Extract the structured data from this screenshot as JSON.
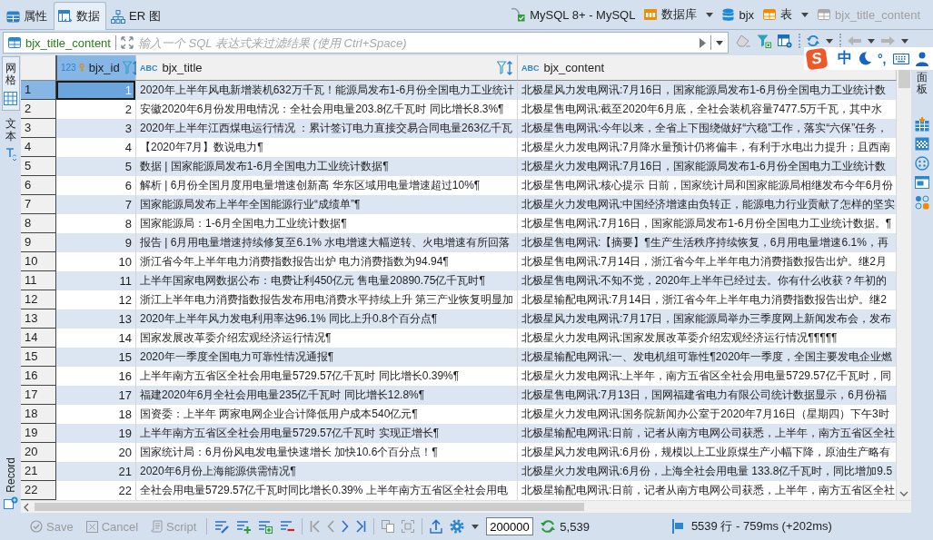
{
  "tabs": [
    {
      "label": "属性",
      "selected": false
    },
    {
      "label": "数据",
      "selected": true
    },
    {
      "label": "ER 图",
      "selected": false
    }
  ],
  "breadcrumb": [
    {
      "label": "MySQL 8+ - MySQL",
      "dropdown": false,
      "disabled": false
    },
    {
      "label": "数据库",
      "dropdown": true,
      "disabled": false
    },
    {
      "label": "bjx",
      "dropdown": false,
      "disabled": false
    },
    {
      "label": "表",
      "dropdown": true,
      "disabled": false
    },
    {
      "label": "bjx_title_content",
      "dropdown": false,
      "disabled": true
    }
  ],
  "filter": {
    "table": "bjx_title_content",
    "placeholder": "输入一个 SQL 表达式来过滤结果 (使用 Ctrl+Space)"
  },
  "ime": {
    "logo": "S",
    "mode": "中",
    "punctuation": "°,"
  },
  "view_tabs": [
    {
      "label": "网格",
      "selected": true
    },
    {
      "label": "文本",
      "selected": false
    }
  ],
  "record": {
    "label": "Record"
  },
  "side_panel": {
    "label": "面板"
  },
  "table": {
    "columns": [
      {
        "name": "bjx_id",
        "type_label": "123",
        "kind": "number",
        "primary_key": true,
        "selected": true,
        "filter_icon": true
      },
      {
        "name": "bjx_title",
        "type_label": "ABC",
        "kind": "text",
        "primary_key": false,
        "selected": false,
        "filter_icon": true
      },
      {
        "name": "bjx_content",
        "type_label": "ABC",
        "kind": "text",
        "primary_key": false,
        "selected": false,
        "filter_icon": false
      }
    ],
    "rows": [
      {
        "row_number": "1",
        "selected": true,
        "cells": [
          "1",
          "2020年上半年风电新增装机632万千瓦！能源局发布1-6月份全国电力工业统计",
          "北极星风力发电网讯:7月16日，国家能源局发布1-6月份全国电力工业统计数"
        ]
      },
      {
        "row_number": "2",
        "selected": false,
        "cells": [
          "2",
          "安徽2020年6月份发用电情况：全社会用电量203.8亿千瓦时 同比增长8.3%¶",
          "北极星售电网讯:截至2020年6月底，全社会装机容量7477.5万千瓦，其中水"
        ]
      },
      {
        "row_number": "3",
        "selected": false,
        "cells": [
          "3",
          "2020年上半年江西煤电运行情况 ：累计签订电力直接交易合同电量263亿千瓦",
          "北极星售电网讯:今年以来，全省上下围绕做好“六稳”工作，落实“六保”任务，"
        ]
      },
      {
        "row_number": "4",
        "selected": false,
        "cells": [
          "4",
          "【2020年7月】数说电力¶",
          "北极星火力发电网讯:7月降水量预计仍将偏丰，有利于水电出力提升；且西南"
        ]
      },
      {
        "row_number": "5",
        "selected": false,
        "cells": [
          "5",
          "数据 | 国家能源局发布1-6月全国电力工业统计数据¶",
          "北极星火力发电网讯:7月16日，国家能源局发布1-6月份全国电力工业统计数"
        ]
      },
      {
        "row_number": "6",
        "selected": false,
        "cells": [
          "6",
          "解析 | 6月份全国月度用电量增速创新高 华东区域用电量增速超过10%¶",
          "北极星售电网讯:核心提示 日前，国家统计局和国家能源局相继发布今年6月份"
        ]
      },
      {
        "row_number": "7",
        "selected": false,
        "cells": [
          "7",
          "国家能源局发布上半年全国能源行业“成绩单”¶",
          "北极星火力发电网讯:中国经济增速由负转正，能源电力行业贡献了怎样的坚实"
        ]
      },
      {
        "row_number": "8",
        "selected": false,
        "cells": [
          "8",
          "国家能源局：1-6月全国电力工业统计数据¶",
          "北极星售电网讯:7月16日，国家能源局发布1-6月份全国电力工业统计数据。¶"
        ]
      },
      {
        "row_number": "9",
        "selected": false,
        "cells": [
          "9",
          "报告 | 6月用电量增速持续修复至6.1% 水电增速大幅逆转、火电增速有所回落",
          "北极星售电网讯:【摘要】¶生产生活秩序持续恢复，6月用电量增速6.1%，再"
        ]
      },
      {
        "row_number": "10",
        "selected": false,
        "cells": [
          "10",
          "浙江省今年上半年电力消费指数报告出炉 电力消费指数为94.94¶",
          "北极星售电网讯:7月14日，浙江省今年上半年电力消费指数报告出炉。继2月"
        ]
      },
      {
        "row_number": "11",
        "selected": false,
        "cells": [
          "11",
          "上半年国家电网数据公布：电费让利450亿元 售电量20890.75亿千瓦时¶",
          "北极星售电网讯:不知不觉，2020年上半年已经过去。你有什么收获？年初的"
        ]
      },
      {
        "row_number": "12",
        "selected": false,
        "cells": [
          "12",
          "浙江上半年电力消费指数报告发布用电消费水平持续上升 第三产业恢复明显加",
          "北极星输配电网讯:7月14日，浙江省今年上半年电力消费指数报告出炉。继2"
        ]
      },
      {
        "row_number": "13",
        "selected": false,
        "cells": [
          "13",
          "2020年上半年风力发电利用率达96.1% 同比上升0.8个百分点¶",
          "北极星风力发电网讯:7月17日，国家能源局举办三季度网上新闻发布会，发布"
        ]
      },
      {
        "row_number": "14",
        "selected": false,
        "cells": [
          "14",
          "国家发展改革委介绍宏观经济运行情况¶",
          "北极星火力发电网讯:国家发展改革委介绍宏观经济运行情况¶¶¶¶¶"
        ]
      },
      {
        "row_number": "15",
        "selected": false,
        "cells": [
          "15",
          "2020年一季度全国电力可靠性情况通报¶",
          "北极星输配电网讯:一、发电机组可靠性¶2020年一季度，全国主要发电企业燃"
        ]
      },
      {
        "row_number": "16",
        "selected": false,
        "cells": [
          "16",
          "上半年南方五省区全社会用电量5729.57亿千瓦时 同比增长0.39%¶",
          "北极星火力发电网讯:上半年，南方五省区全社会用电量5729.57亿千瓦时，同"
        ]
      },
      {
        "row_number": "17",
        "selected": false,
        "cells": [
          "17",
          "福建2020年6月全社会用电量235亿千瓦时 同比增长12.8%¶",
          "北极星售电网讯:7月13日，国网福建省电力有限公司统计数据显示，6月份福"
        ]
      },
      {
        "row_number": "18",
        "selected": false,
        "cells": [
          "18",
          "国资委：上半年 两家电网企业合计降低用户成本540亿元¶",
          "北极星火力发电网讯:国务院新闻办公室于2020年7月16日（星期四）下午3时"
        ]
      },
      {
        "row_number": "19",
        "selected": false,
        "cells": [
          "19",
          "上半年南方五省区全社会用电量5729.57亿千瓦时 实现正增长¶",
          "北极星输配电网讯:日前，记者从南方电网公司获悉，上半年，南方五省区全社"
        ]
      },
      {
        "row_number": "20",
        "selected": false,
        "cells": [
          "20",
          "国家统计局：6月份风电发电量快速增长 加快10.6个百分点！¶",
          "北极星风力发电网讯:6月份，规模以上工业原煤生产小幅下降，原油生产略有"
        ]
      },
      {
        "row_number": "21",
        "selected": false,
        "cells": [
          "21",
          "2020年6月份上海能源供需情况¶",
          "北极星火力发电网讯:6月份，上海全社会用电量 133.8亿千瓦时，同比增加9.5"
        ]
      },
      {
        "row_number": "22",
        "selected": false,
        "cells": [
          "22",
          "全社会用电量5729.57亿千瓦时同比增长0.39% 上半年南方五省区全社会用电",
          "北极星输配电网讯:日前，记者从南方电网公司获悉，上半年，南方五省区全社"
        ]
      }
    ]
  },
  "bottom_bar": {
    "buttons": [
      {
        "label": "Save",
        "disabled": true
      },
      {
        "label": "Cancel",
        "disabled": true
      },
      {
        "label": "Script",
        "disabled": true
      }
    ],
    "fetch_size": "200000",
    "row_count": "5,539",
    "status": "5539 行 - 759ms (+202ms)"
  }
}
